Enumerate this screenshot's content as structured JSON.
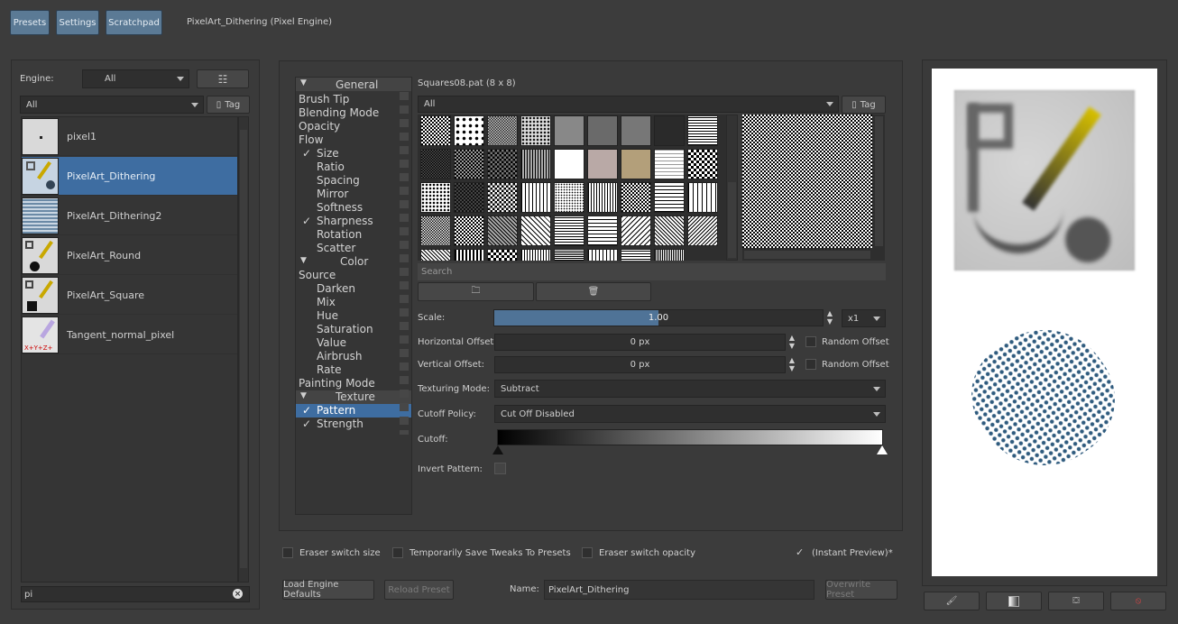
{
  "top": {
    "presets": "Presets",
    "settings": "Settings",
    "scratchpad": "Scratchpad",
    "title": "PixelArt_Dithering (Pixel Engine)"
  },
  "left": {
    "engine_label": "Engine:",
    "engine_value": "All",
    "tag_filter": "All",
    "tag_btn": "Tag",
    "presets": [
      "pixel1",
      "PixelArt_Dithering",
      "PixelArt_Dithering2",
      "PixelArt_Round",
      "PixelArt_Square",
      "Tangent_normal_pixel"
    ],
    "search": "pi"
  },
  "options": {
    "general": "General",
    "brush_tip": "Brush Tip",
    "blending": "Blending Mode",
    "opacity": "Opacity",
    "flow": "Flow",
    "size": "Size",
    "ratio": "Ratio",
    "spacing": "Spacing",
    "mirror": "Mirror",
    "softness": "Softness",
    "sharpness": "Sharpness",
    "rotation": "Rotation",
    "scatter": "Scatter",
    "color": "Color",
    "source": "Source",
    "darken": "Darken",
    "mix": "Mix",
    "hue": "Hue",
    "saturation": "Saturation",
    "value": "Value",
    "airbrush": "Airbrush",
    "rate": "Rate",
    "painting_mode": "Painting Mode",
    "texture": "Texture",
    "pattern": "Pattern",
    "strength": "Strength"
  },
  "texture": {
    "pattern_name": "Squares08.pat (8 x 8)",
    "filter": "All",
    "tag": "Tag",
    "search": "Search",
    "scale_label": "Scale:",
    "scale_value": "1.00",
    "scale_fraction": 0.5,
    "scale_mult": "x1",
    "hoff_label": "Horizontal Offset:",
    "hoff_value": "0 px",
    "voff_label": "Vertical Offset:",
    "voff_value": "0 px",
    "random_offset": "Random Offset",
    "mode_label": "Texturing Mode:",
    "mode_value": "Subtract",
    "cutoff_policy_label": "Cutoff Policy:",
    "cutoff_policy_value": "Cut Off Disabled",
    "cutoff_label": "Cutoff:",
    "invert_label": "Invert Pattern:"
  },
  "bottom": {
    "eraser_size": "Eraser switch size",
    "temp_save": "Temporarily Save Tweaks To Presets",
    "eraser_opacity": "Eraser switch opacity",
    "instant": "(Instant Preview)*",
    "load_defaults": "Load Engine Defaults",
    "reload": "Reload Preset",
    "name_label": "Name:",
    "name_value": "PixelArt_Dithering",
    "overwrite": "Overwrite Preset"
  },
  "colors": {
    "accent": "#3e6da1",
    "button": "#5b7a95"
  }
}
